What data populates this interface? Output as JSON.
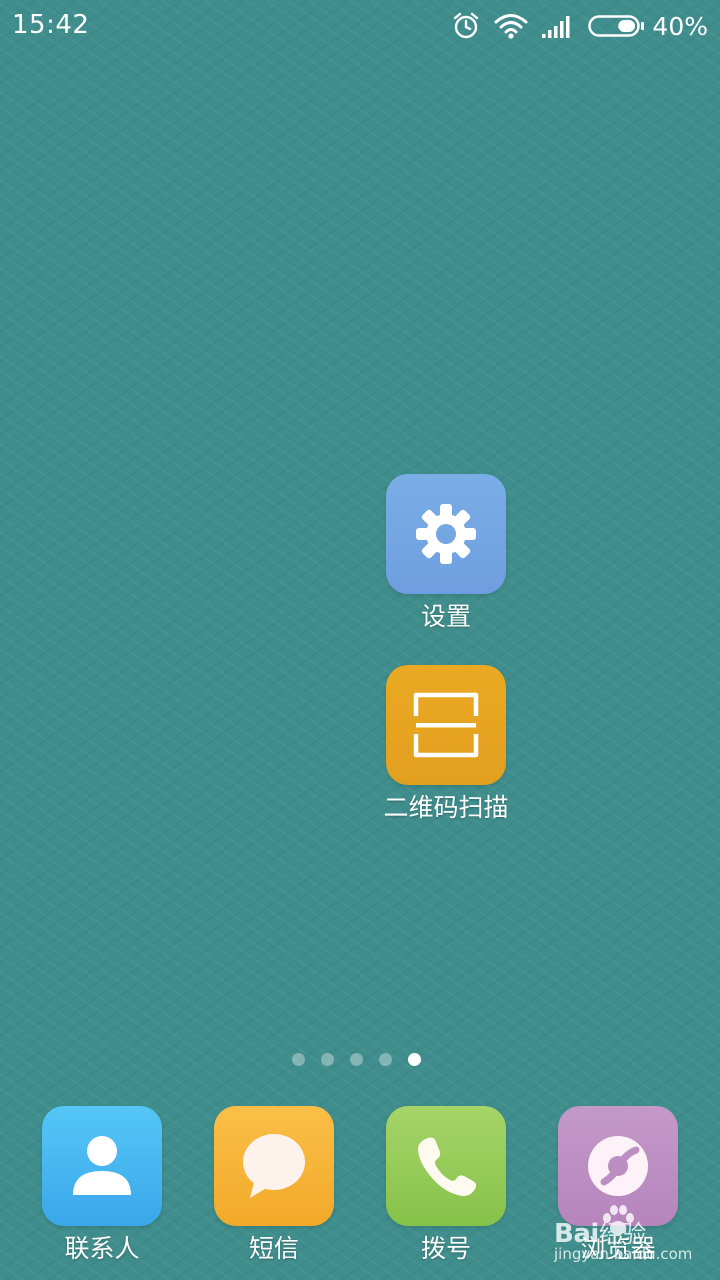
{
  "status_bar": {
    "time": "15:42",
    "icons": [
      "alarm-icon",
      "wifi-icon",
      "signal-icon",
      "battery-icon"
    ],
    "battery_percent": "40%",
    "battery_level": 0.4
  },
  "home": {
    "apps": [
      {
        "id": "settings",
        "label": "设置",
        "icon": "gear-icon",
        "color": "#74a6e2"
      },
      {
        "id": "qrscan",
        "label": "二维码扫描",
        "icon": "scan-frame-icon",
        "color": "#e6a521"
      }
    ]
  },
  "page_indicator": {
    "count": 5,
    "active_index": 4
  },
  "dock": {
    "apps": [
      {
        "id": "contacts",
        "label": "联系人",
        "icon": "person-icon",
        "color": "#46b5f0"
      },
      {
        "id": "sms",
        "label": "短信",
        "icon": "speech-bubble-icon",
        "color": "#f6b438"
      },
      {
        "id": "dialer",
        "label": "拨号",
        "icon": "phone-icon",
        "color": "#96cb59"
      },
      {
        "id": "browser",
        "label": "浏览器",
        "icon": "browser-logo-icon",
        "color": "#bc8fc2"
      }
    ]
  },
  "watermark": {
    "brand": "Bai",
    "brand_suffix": "经验",
    "url": "jingyan.baidu.com"
  }
}
